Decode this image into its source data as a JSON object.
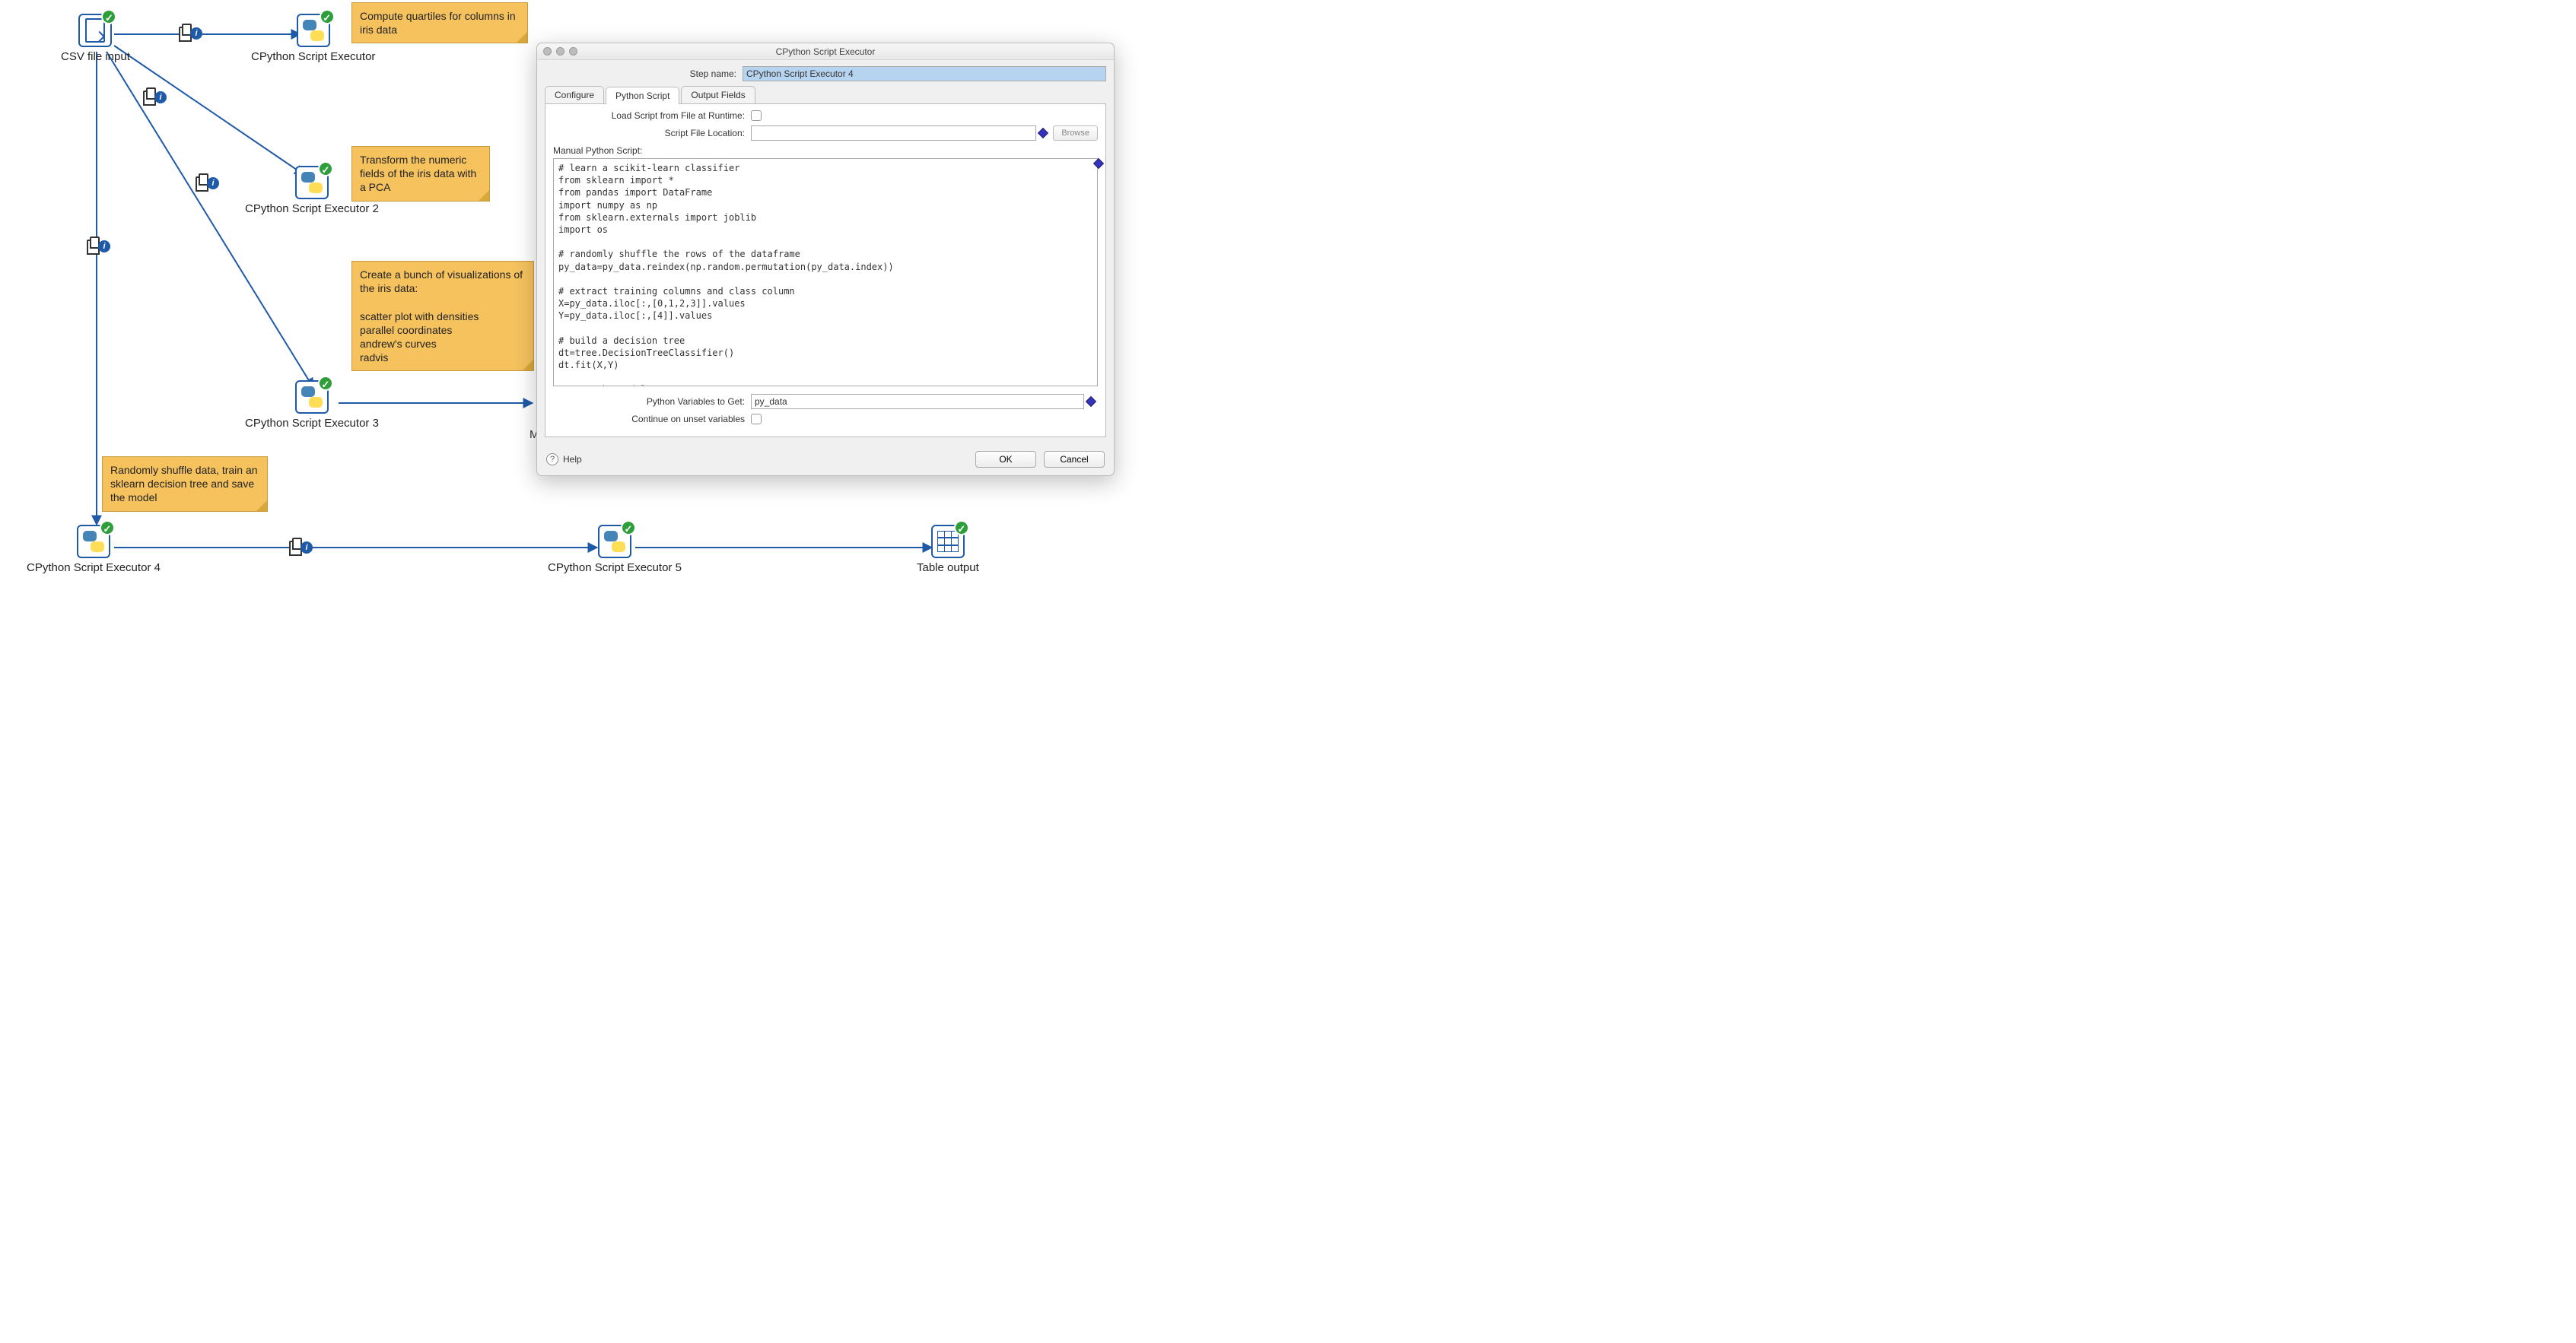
{
  "nodes": {
    "csv": {
      "label": "CSV file input"
    },
    "py1": {
      "label": "CPython Script Executor"
    },
    "py2": {
      "label": "CPython Script Executor 2"
    },
    "py3": {
      "label": "CPython Script Executor 3"
    },
    "py4": {
      "label": "CPython Script Executor 4"
    },
    "py5": {
      "label": "CPython Script Executor 5"
    },
    "tbl": {
      "label": "Table output"
    }
  },
  "stickies": {
    "s1": "Compute quartiles for columns in iris data",
    "s2": "Transform the numeric fields of the iris data with a PCA",
    "s3": "Create a bunch of visualizations of the iris data:\n\nscatter plot with densities\nparallel coordinates\nandrew's curves\nradvis",
    "s4": "Randomly shuffle data, train an sklearn decision tree and save the model"
  },
  "dialog": {
    "title": "CPython Script Executor",
    "step_name_label": "Step name:",
    "step_name_value": "CPython Script Executor 4",
    "tabs": {
      "configure": "Configure",
      "script": "Python Script",
      "fields": "Output Fields"
    },
    "load_runtime_label": "Load Script from File at Runtime:",
    "file_location_label": "Script File Location:",
    "file_location_value": "",
    "browse": "Browse",
    "manual_label": "Manual Python Script:",
    "code": "# learn a scikit-learn classifier\nfrom sklearn import *\nfrom pandas import DataFrame\nimport numpy as np\nfrom sklearn.externals import joblib\nimport os\n\n# randomly shuffle the rows of the dataframe\npy_data=py_data.reindex(np.random.permutation(py_data.index))\n\n# extract training columns and class column\nX=py_data.iloc[:,[0,1,2,3]].values\nY=py_data.iloc[:,[4]].values\n\n# build a decision tree\ndt=tree.DecisionTreeClassifier()\ndt.fit(X,Y)\n\n# save the model\nfilename='${Internal.Transformation.Filename.Directory}/dt.sklearn'\nif os.name == 'nt':\n    filename=filename[8:] # strip file:/// off\nelse:\n    filename=filename[7:] # strip the \"file://\" off (probably needs changing for windows paths...)\njoblib.dump(dt,filename)",
    "vars_label": "Python Variables to Get:",
    "vars_value": "py_data",
    "continue_label": "Continue on unset variables",
    "help": "Help",
    "ok": "OK",
    "cancel": "Cancel"
  },
  "partial_label": "M"
}
